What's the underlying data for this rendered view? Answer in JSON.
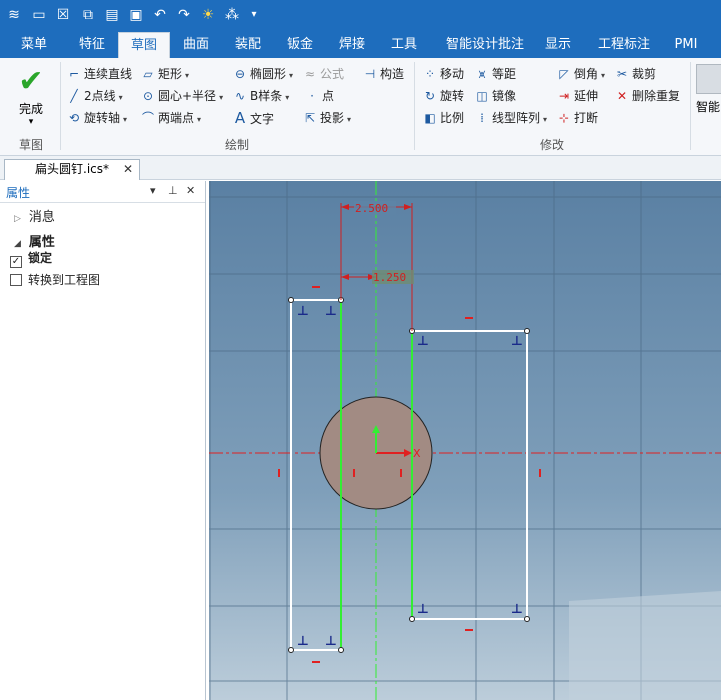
{
  "quickbar": {
    "icons": [
      "app-logo-icon",
      "new-icon",
      "close-doc-icon",
      "export-icon",
      "open-icon",
      "save-icon",
      "undo-icon",
      "redo-icon",
      "brightness-icon",
      "snap-icon",
      "dropdown-icon"
    ]
  },
  "tabs": [
    "菜单",
    "特征",
    "草图",
    "曲面",
    "装配",
    "钣金",
    "焊接",
    "工具",
    "智能设计批注",
    "显示",
    "工程标注",
    "PMI"
  ],
  "active_tab": "草图",
  "ribbon": {
    "finish": {
      "label": "完成",
      "dropdown": "▾"
    },
    "groups": {
      "sketch": "草图",
      "draw": "绘制",
      "modify": "修改"
    },
    "draw": {
      "polyline": "连续直线",
      "rect": "矩形",
      "ellipse": "椭圆形",
      "formula": "公式",
      "construct": "构造",
      "two_point_line": "2点线",
      "circle_center": "圆心+半径",
      "bspline": "B样条",
      "point": "点",
      "rotate_axis": "旋转轴",
      "two_end_arc": "两端点",
      "text": "文字",
      "project": "投影"
    },
    "modify": {
      "move": "移动",
      "offset": "等距",
      "chamfer": "倒角",
      "trim": "裁剪",
      "rotate": "旋转",
      "mirror": "镜像",
      "extend": "延伸",
      "delete_dup": "删除重复",
      "scale": "比例",
      "linear_array": "线型阵列",
      "break": "打断",
      "smart": "智能"
    }
  },
  "document": {
    "tab_title": "扁头圆钉.ics*"
  },
  "panel": {
    "title": "属性",
    "messages": "消息",
    "properties": "属性",
    "lock_label": "锁定",
    "lock_checked": true,
    "convert_label": "转换到工程图",
    "convert_checked": false
  },
  "canvas": {
    "dim_width": "2.500",
    "dim_half": "1.250",
    "axis_label": "X",
    "colors": {
      "background_top": "#5e84a6",
      "background_bottom": "#b8cbd9",
      "grid": "#4e6e8a",
      "sketch": "#ffffff",
      "selected": "#33ee33",
      "constraint": "#e02020",
      "dimension": "#d02020",
      "circle_fill": "#a08a82"
    }
  }
}
